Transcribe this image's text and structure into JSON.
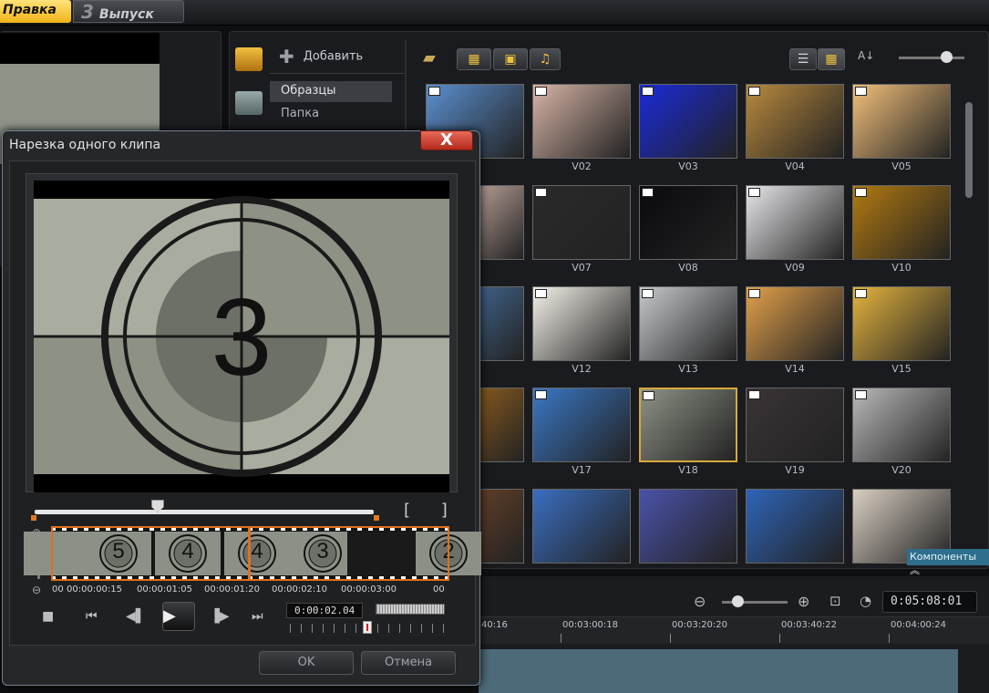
{
  "header": {
    "tab_edit": "Правка",
    "tab_output_num": "3",
    "tab_output": "Выпуск"
  },
  "library": {
    "add_label": "Добавить",
    "sidebar": [
      "Образцы",
      "Папка"
    ],
    "components_label": "Компоненты",
    "thumbnails": [
      {
        "label": "",
        "bg": "#5a8fcf"
      },
      {
        "label": "V02",
        "bg": "#d7b4a6"
      },
      {
        "label": "V03",
        "bg": "#1a2bd9"
      },
      {
        "label": "V04",
        "bg": "#b88a3e"
      },
      {
        "label": "V05",
        "bg": "#f2c07a"
      },
      {
        "label": "",
        "bg": "#f2d0c4"
      },
      {
        "label": "V07",
        "bg": "#2a2a2a"
      },
      {
        "label": "V08",
        "bg": "#0a0a0f"
      },
      {
        "label": "V09",
        "bg": "#e7e7ea"
      },
      {
        "label": "V10",
        "bg": "#b27a10"
      },
      {
        "label": "",
        "bg": "#4d7db3"
      },
      {
        "label": "V12",
        "bg": "#f5f2ea"
      },
      {
        "label": "V13",
        "bg": "#c6c9cc"
      },
      {
        "label": "V14",
        "bg": "#e2a04a"
      },
      {
        "label": "V15",
        "bg": "#e4b43e"
      },
      {
        "label": "",
        "bg": "#b0701c"
      },
      {
        "label": "V17",
        "bg": "#3a77c4"
      },
      {
        "label": "V18",
        "bg": "#8d9285"
      },
      {
        "label": "V19",
        "bg": "#3a3436"
      },
      {
        "label": "V20",
        "bg": "#b9b9b9"
      },
      {
        "label": "",
        "bg": "#7a4a2a"
      },
      {
        "label": "",
        "bg": "#3a6ec0"
      },
      {
        "label": "",
        "bg": "#4a52a8"
      },
      {
        "label": "",
        "bg": "#2e64b8"
      },
      {
        "label": "",
        "bg": "#d9cfc2"
      }
    ]
  },
  "timeline": {
    "current_time": "0:05:08:01",
    "ruler_labels": [
      "40:16",
      "00:03:00:18",
      "00:03:20:20",
      "00:03:40:22",
      "00:04:00:24"
    ]
  },
  "dialog": {
    "title": "Нарезка одного клипа",
    "close": "X",
    "brackets": "[ ]",
    "strip_numbers": [
      "5",
      "4",
      "4",
      "3",
      "2"
    ],
    "strip_timecodes": [
      "00",
      "00:00:00:15",
      "00:00:01:05",
      "00:00:01:20",
      "00:00:02:10",
      "00:00:03:00",
      "00"
    ],
    "timecode": "0:00:02.04",
    "ok": "OK",
    "cancel": "Отмена",
    "video_number": "3",
    "zoom_in": "⊕",
    "zoom_out": "⊖"
  }
}
